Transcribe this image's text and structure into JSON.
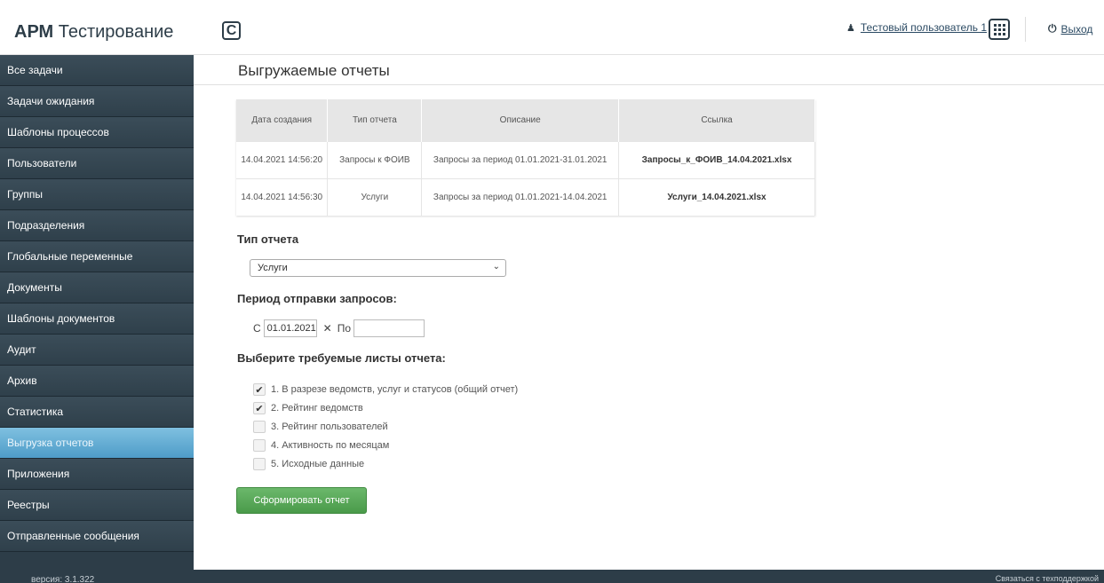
{
  "header": {
    "brand_bold": "АРМ",
    "brand_rest": " Тестирование",
    "logo_letter": "C",
    "user_name": "Тестовый пользователь 1",
    "logout": "Выход"
  },
  "sidebar": {
    "items": [
      {
        "label": "Все задачи"
      },
      {
        "label": "Задачи ожидания"
      },
      {
        "label": "Шаблоны процессов"
      },
      {
        "label": "Пользователи"
      },
      {
        "label": "Группы"
      },
      {
        "label": "Подразделения"
      },
      {
        "label": "Глобальные переменные"
      },
      {
        "label": "Документы"
      },
      {
        "label": "Шаблоны документов"
      },
      {
        "label": "Аудит"
      },
      {
        "label": "Архив"
      },
      {
        "label": "Статистика"
      },
      {
        "label": "Выгрузка отчетов",
        "active": true
      },
      {
        "label": "Приложения"
      },
      {
        "label": "Реестры"
      },
      {
        "label": "Отправленные сообщения"
      }
    ],
    "version": "версия: 3.1.322"
  },
  "main": {
    "title": "Выгружаемые отчеты",
    "table": {
      "headers": [
        "Дата создания",
        "Тип отчета",
        "Описание",
        "Ссылка"
      ],
      "rows": [
        [
          "14.04.2021 14:56:20",
          "Запросы к ФОИВ",
          "Запросы за период 01.01.2021-31.01.2021",
          "Запросы_к_ФОИВ_14.04.2021.xlsx"
        ],
        [
          "14.04.2021 14:56:30",
          "Услуги",
          "Запросы за период 01.01.2021-14.04.2021",
          "Услуги_14.04.2021.xlsx"
        ]
      ]
    },
    "report_type_label": "Тип отчета",
    "report_type_value": "Услуги",
    "period_label": "Период отправки запросов:",
    "period_from_label": "С",
    "period_from_value": "01.01.2021",
    "period_to_label": "По",
    "period_to_value": "",
    "sheets_label": "Выберите требуемые листы отчета:",
    "sheets": [
      {
        "label": "1. В разрезе ведомств, услуг и статусов (общий отчет)",
        "checked": true
      },
      {
        "label": "2. Рейтинг ведомств",
        "checked": true
      },
      {
        "label": "3. Рейтинг пользователей",
        "checked": false
      },
      {
        "label": "4. Активность по месяцам",
        "checked": false
      },
      {
        "label": "5. Исходные данные",
        "checked": false
      }
    ],
    "submit_label": "Сформировать отчет"
  },
  "footer": {
    "support": "Связаться с техподдержкой"
  }
}
